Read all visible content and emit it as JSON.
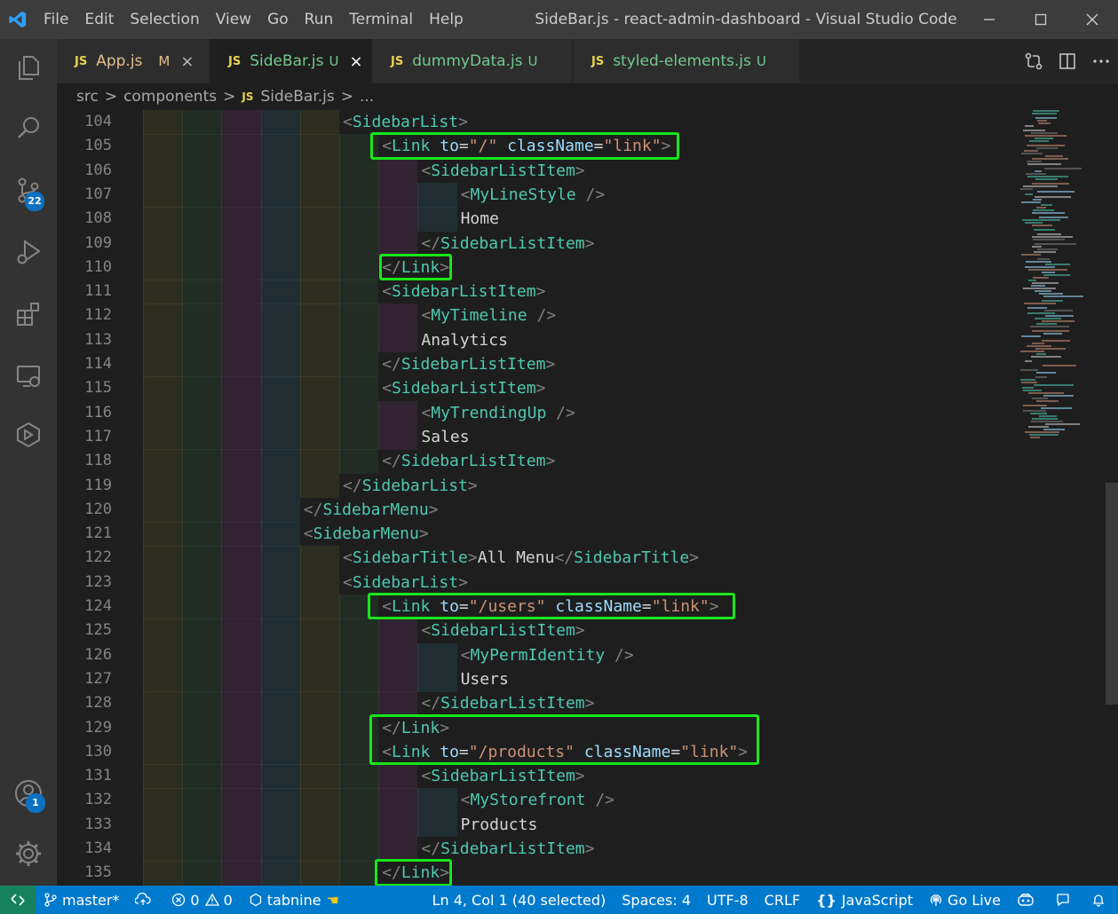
{
  "window": {
    "title": "SideBar.js - react-admin-dashboard - Visual Studio Code",
    "menu": [
      "File",
      "Edit",
      "Selection",
      "View",
      "Go",
      "Run",
      "Terminal",
      "Help"
    ]
  },
  "activity_bar": {
    "source_control_badge": "22",
    "accounts_badge": "1"
  },
  "tabs": [
    {
      "icon": "JS",
      "name": "App.js",
      "status": "M",
      "close": "×"
    },
    {
      "icon": "JS",
      "name": "SideBar.js",
      "status": "U",
      "close": "×"
    },
    {
      "icon": "JS",
      "name": "dummyData.js",
      "status": "U"
    },
    {
      "icon": "JS",
      "name": "styled-elements.js",
      "status": "U"
    }
  ],
  "breadcrumb": {
    "items": [
      "src",
      "components",
      "SideBar.js",
      "..."
    ],
    "file_icon": "JS",
    "separator": ">"
  },
  "editor": {
    "line_numbers": [
      "104",
      "105",
      "106",
      "107",
      "108",
      "109",
      "110",
      "111",
      "112",
      "113",
      "114",
      "115",
      "116",
      "117",
      "118",
      "119",
      "120",
      "121",
      "122",
      "123",
      "124",
      "125",
      "126",
      "127",
      "128",
      "129",
      "130",
      "131",
      "132",
      "133",
      "134",
      "135"
    ],
    "lines": [
      [
        [
          "tg",
          "<"
        ],
        [
          "tn",
          "SidebarList"
        ],
        [
          "tg",
          ">"
        ]
      ],
      [
        [
          "tg",
          "<"
        ],
        [
          "tn",
          "Link"
        ],
        [
          "tx",
          " "
        ],
        [
          "at",
          "to"
        ],
        [
          "tx",
          "="
        ],
        [
          "st",
          "\"/\""
        ],
        [
          "tx",
          " "
        ],
        [
          "at",
          "className"
        ],
        [
          "tx",
          "="
        ],
        [
          "st",
          "\"link\""
        ],
        [
          "tg",
          ">"
        ]
      ],
      [
        [
          "tg",
          "<"
        ],
        [
          "tn",
          "SidebarListItem"
        ],
        [
          "tg",
          ">"
        ]
      ],
      [
        [
          "tg",
          "<"
        ],
        [
          "tn",
          "MyLineStyle"
        ],
        [
          "tx",
          " "
        ],
        [
          "tg",
          "/>"
        ]
      ],
      [
        [
          "tx",
          "Home"
        ]
      ],
      [
        [
          "tg",
          "</"
        ],
        [
          "tn",
          "SidebarListItem"
        ],
        [
          "tg",
          ">"
        ]
      ],
      [
        [
          "tg",
          "</"
        ],
        [
          "tn",
          "Link"
        ],
        [
          "tg",
          ">"
        ]
      ],
      [
        [
          "tg",
          "<"
        ],
        [
          "tn",
          "SidebarListItem"
        ],
        [
          "tg",
          ">"
        ]
      ],
      [
        [
          "tg",
          "<"
        ],
        [
          "tn",
          "MyTimeline"
        ],
        [
          "tx",
          " "
        ],
        [
          "tg",
          "/>"
        ]
      ],
      [
        [
          "tx",
          "Analytics"
        ]
      ],
      [
        [
          "tg",
          "</"
        ],
        [
          "tn",
          "SidebarListItem"
        ],
        [
          "tg",
          ">"
        ]
      ],
      [
        [
          "tg",
          "<"
        ],
        [
          "tn",
          "SidebarListItem"
        ],
        [
          "tg",
          ">"
        ]
      ],
      [
        [
          "tg",
          "<"
        ],
        [
          "tn",
          "MyTrendingUp"
        ],
        [
          "tx",
          " "
        ],
        [
          "tg",
          "/>"
        ]
      ],
      [
        [
          "tx",
          "Sales"
        ]
      ],
      [
        [
          "tg",
          "</"
        ],
        [
          "tn",
          "SidebarListItem"
        ],
        [
          "tg",
          ">"
        ]
      ],
      [
        [
          "tg",
          "</"
        ],
        [
          "tn",
          "SidebarList"
        ],
        [
          "tg",
          ">"
        ]
      ],
      [
        [
          "tg",
          "</"
        ],
        [
          "tn",
          "SidebarMenu"
        ],
        [
          "tg",
          ">"
        ]
      ],
      [
        [
          "tg",
          "<"
        ],
        [
          "tn",
          "SidebarMenu"
        ],
        [
          "tg",
          ">"
        ]
      ],
      [
        [
          "tg",
          "<"
        ],
        [
          "tn",
          "SidebarTitle"
        ],
        [
          "tg",
          ">"
        ],
        [
          "tx",
          "All Menu"
        ],
        [
          "tg",
          "</"
        ],
        [
          "tn",
          "SidebarTitle"
        ],
        [
          "tg",
          ">"
        ]
      ],
      [
        [
          "tg",
          "<"
        ],
        [
          "tn",
          "SidebarList"
        ],
        [
          "tg",
          ">"
        ]
      ],
      [
        [
          "tg",
          "<"
        ],
        [
          "tn",
          "Link"
        ],
        [
          "tx",
          " "
        ],
        [
          "at",
          "to"
        ],
        [
          "tx",
          "="
        ],
        [
          "st",
          "\"/users\""
        ],
        [
          "tx",
          " "
        ],
        [
          "at",
          "className"
        ],
        [
          "tx",
          "="
        ],
        [
          "st",
          "\"link\""
        ],
        [
          "tg",
          ">"
        ]
      ],
      [
        [
          "tg",
          "<"
        ],
        [
          "tn",
          "SidebarListItem"
        ],
        [
          "tg",
          ">"
        ]
      ],
      [
        [
          "tg",
          "<"
        ],
        [
          "tn",
          "MyPermIdentity"
        ],
        [
          "tx",
          " "
        ],
        [
          "tg",
          "/>"
        ]
      ],
      [
        [
          "tx",
          "Users"
        ]
      ],
      [
        [
          "tg",
          "</"
        ],
        [
          "tn",
          "SidebarListItem"
        ],
        [
          "tg",
          ">"
        ]
      ],
      [
        [
          "tg",
          "</"
        ],
        [
          "tn",
          "Link"
        ],
        [
          "tg",
          ">"
        ]
      ],
      [
        [
          "tg",
          "<"
        ],
        [
          "tn",
          "Link"
        ],
        [
          "tx",
          " "
        ],
        [
          "at",
          "to"
        ],
        [
          "tx",
          "="
        ],
        [
          "st",
          "\"/products\""
        ],
        [
          "tx",
          " "
        ],
        [
          "at",
          "className"
        ],
        [
          "tx",
          "="
        ],
        [
          "st",
          "\"link\""
        ],
        [
          "tg",
          ">"
        ]
      ],
      [
        [
          "tg",
          "<"
        ],
        [
          "tn",
          "SidebarListItem"
        ],
        [
          "tg",
          ">"
        ]
      ],
      [
        [
          "tg",
          "<"
        ],
        [
          "tn",
          "MyStorefront"
        ],
        [
          "tx",
          " "
        ],
        [
          "tg",
          "/>"
        ]
      ],
      [
        [
          "tx",
          "Products"
        ]
      ],
      [
        [
          "tg",
          "</"
        ],
        [
          "tn",
          "SidebarListItem"
        ],
        [
          "tg",
          ">"
        ]
      ],
      [
        [
          "tg",
          "</"
        ],
        [
          "tn",
          "Link"
        ],
        [
          "tg",
          ">"
        ]
      ]
    ],
    "indents": [
      5,
      6,
      7,
      8,
      8,
      7,
      6,
      6,
      7,
      7,
      6,
      6,
      7,
      7,
      6,
      5,
      4,
      4,
      5,
      5,
      6,
      7,
      8,
      8,
      7,
      6,
      6,
      7,
      8,
      8,
      7,
      6
    ],
    "highlighted_lines": [
      "105",
      "110",
      "124",
      "129-130",
      "135"
    ]
  },
  "status_bar": {
    "branch": "master*",
    "errors": "0",
    "warnings": "0",
    "tabnine": "tabnine",
    "cursor": "Ln 4, Col 1 (40 selected)",
    "spaces": "Spaces: 4",
    "encoding": "UTF-8",
    "eol": "CRLF",
    "language": "JavaScript",
    "golive": "Go Live"
  },
  "colors": {
    "titlebar": "#3c3c3c",
    "activitybar": "#333333",
    "editor_bg": "#1e1e1e",
    "statusbar": "#007acc",
    "highlight_box": "#19e619",
    "tag_name": "#4ec9b0",
    "attr_name": "#9cdcfe",
    "string": "#ce9178"
  },
  "icons": [
    "vscode-logo-icon",
    "minimize-icon",
    "maximize-icon",
    "close-icon",
    "explorer-icon",
    "search-icon",
    "source-control-icon",
    "run-debug-icon",
    "extensions-icon",
    "remote-explorer-icon",
    "docker-icon",
    "accounts-icon",
    "settings-gear-icon",
    "compare-changes-icon",
    "split-editor-icon",
    "more-actions-icon",
    "remote-icon",
    "branch-icon",
    "sync-icon",
    "error-icon",
    "warning-icon",
    "tabnine-icon",
    "golive-icon",
    "copilot-icon",
    "feedback-icon",
    "bell-icon"
  ]
}
